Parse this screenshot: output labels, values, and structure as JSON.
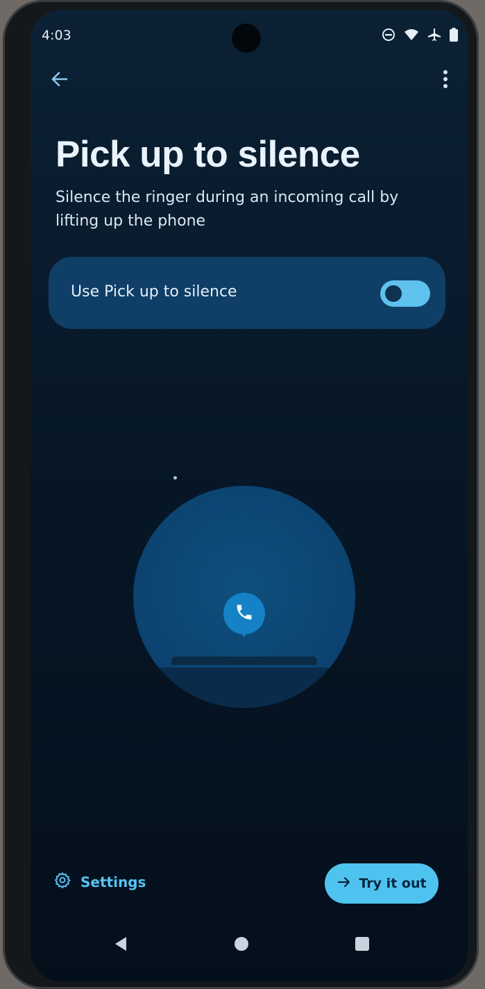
{
  "status_bar": {
    "time": "4:03",
    "icons": [
      "do-not-disturb-icon",
      "wifi-icon",
      "airplane-icon",
      "battery-icon"
    ]
  },
  "app_bar": {
    "back_icon": "arrow-left-icon",
    "more_icon": "more-vert-icon"
  },
  "header": {
    "title": "Pick up to silence",
    "subtitle": "Silence the ringer during an incoming call by lifting up the phone"
  },
  "toggle": {
    "label": "Use Pick up to silence",
    "enabled": false
  },
  "illustration": {
    "icon": "phone-call-icon"
  },
  "footer": {
    "settings_label": "Settings",
    "settings_icon": "gear-icon",
    "try_label": "Try it out",
    "try_icon": "arrow-right-icon"
  },
  "colors": {
    "accent": "#4fc3f0",
    "card": "#0f3f66",
    "background": "#071727"
  },
  "nav_bar": {
    "buttons": [
      "nav-back-icon",
      "nav-home-icon",
      "nav-recents-icon"
    ]
  }
}
